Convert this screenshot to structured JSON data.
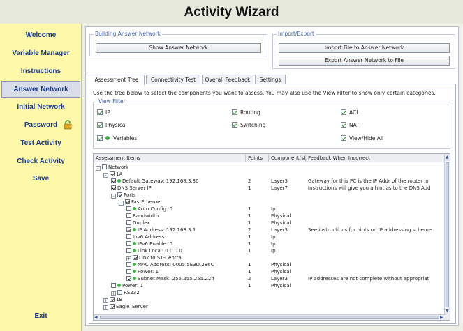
{
  "app": {
    "title": "Activity Wizard"
  },
  "sidebar": {
    "items": [
      {
        "label": "Welcome"
      },
      {
        "label": "Variable Manager"
      },
      {
        "label": "Instructions"
      },
      {
        "label": "Answer Network"
      },
      {
        "label": "Initial Network"
      },
      {
        "label": "Password"
      },
      {
        "label": "Test Activity"
      },
      {
        "label": "Check Activity"
      },
      {
        "label": "Save"
      }
    ],
    "active": "Answer Network",
    "exit_label": "Exit"
  },
  "building": {
    "group_title": "Building Answer Network",
    "show_button": "Show Answer Network"
  },
  "import_export": {
    "group_title": "Import/Export",
    "import_button": "Import File to Answer Network",
    "export_button": "Export Answer Network to File"
  },
  "tabs": [
    {
      "label": "Assessment Tree",
      "active": true
    },
    {
      "label": "Connectivity Test",
      "active": false
    },
    {
      "label": "Overall Feedback",
      "active": false
    },
    {
      "label": "Settings",
      "active": false
    }
  ],
  "instruction": "Use the tree below to select the components you want to assess. You may also use the View Filter to show only certain categories.",
  "view_filter": {
    "title": "View Filter",
    "options": [
      {
        "label": "IP",
        "checked": true
      },
      {
        "label": "Routing",
        "checked": true
      },
      {
        "label": "ACL",
        "checked": true
      },
      {
        "label": "Physical",
        "checked": true
      },
      {
        "label": "Switching",
        "checked": true
      },
      {
        "label": "NAT",
        "checked": true
      },
      {
        "label": "Variables",
        "checked": true
      },
      {
        "label": "View/Hide All",
        "checked": true
      }
    ]
  },
  "grid": {
    "columns": [
      "Assessment Items",
      "Points",
      "Component(s)",
      "Feedback When Incorrect"
    ],
    "rows": [
      {
        "label": "Network",
        "level": 0,
        "expand": "-",
        "check": false,
        "dot": false,
        "points": "",
        "component": "",
        "feedback": ""
      },
      {
        "label": "1A",
        "level": 1,
        "expand": "-",
        "check": true,
        "dot": false,
        "points": "",
        "component": "",
        "feedback": ""
      },
      {
        "label": "Default Gateway: 192.168.3.30",
        "level": 2,
        "expand": "",
        "check": true,
        "dot": true,
        "points": "2",
        "component": "Layer3",
        "feedback": "Gateway for this PC is the IP Addr of the router in"
      },
      {
        "label": "DNS Server IP",
        "level": 2,
        "expand": "",
        "check": true,
        "dot": false,
        "points": "1",
        "component": "Layer7",
        "feedback": "Instructions will give you a hint as to the DNS Add"
      },
      {
        "label": "Ports",
        "level": 2,
        "expand": "-",
        "check": true,
        "dot": false,
        "points": "",
        "component": "",
        "feedback": ""
      },
      {
        "label": "FastEthernet",
        "level": 3,
        "expand": "-",
        "check": true,
        "dot": false,
        "points": "",
        "component": "",
        "feedback": ""
      },
      {
        "label": "Auto Config: 0",
        "level": 4,
        "expand": "",
        "check": false,
        "dot": true,
        "points": "1",
        "component": "Ip",
        "feedback": ""
      },
      {
        "label": "Bandwidth",
        "level": 4,
        "expand": "",
        "check": false,
        "dot": false,
        "points": "1",
        "component": "Physical",
        "feedback": ""
      },
      {
        "label": "Duplex",
        "level": 4,
        "expand": "",
        "check": false,
        "dot": false,
        "points": "1",
        "component": "Physical",
        "feedback": ""
      },
      {
        "label": "IP Address: 192.168.3.1",
        "level": 4,
        "expand": "",
        "check": true,
        "dot": true,
        "points": "2",
        "component": "Layer3",
        "feedback": "See instructions for hints on IP addressing scheme"
      },
      {
        "label": "Ipv6 Address",
        "level": 4,
        "expand": "",
        "check": false,
        "dot": false,
        "points": "1",
        "component": "Ip",
        "feedback": ""
      },
      {
        "label": "IPv6 Enable: 0",
        "level": 4,
        "expand": "",
        "check": false,
        "dot": true,
        "points": "1",
        "component": "Ip",
        "feedback": ""
      },
      {
        "label": "Link Local: 0.0.0.0",
        "level": 4,
        "expand": "",
        "check": false,
        "dot": true,
        "points": "1",
        "component": "Ip",
        "feedback": ""
      },
      {
        "label": "Link to S1-Central",
        "level": 4,
        "expand": "+",
        "check": true,
        "dot": false,
        "points": "",
        "component": "",
        "feedback": ""
      },
      {
        "label": "MAC Address: 0005.5E3D.286C",
        "level": 4,
        "expand": "",
        "check": false,
        "dot": true,
        "points": "1",
        "component": "Physical",
        "feedback": ""
      },
      {
        "label": "Power: 1",
        "level": 4,
        "expand": "",
        "check": false,
        "dot": true,
        "points": "1",
        "component": "Physical",
        "feedback": ""
      },
      {
        "label": "Subnet Mask: 255.255.255.224",
        "level": 4,
        "expand": "",
        "check": true,
        "dot": true,
        "points": "2",
        "component": "Layer3",
        "feedback": "IP addresses are not complete without appropriat"
      },
      {
        "label": "Power: 1",
        "level": 2,
        "expand": "",
        "check": false,
        "dot": true,
        "points": "1",
        "component": "Physical",
        "feedback": ""
      },
      {
        "label": "RS232",
        "level": 2,
        "expand": "+",
        "check": false,
        "dot": false,
        "points": "",
        "component": "",
        "feedback": ""
      },
      {
        "label": "1B",
        "level": 1,
        "expand": "+",
        "check": true,
        "dot": false,
        "points": "",
        "component": "",
        "feedback": ""
      },
      {
        "label": "Eagle_Server",
        "level": 1,
        "expand": "+",
        "check": true,
        "dot": false,
        "points": "",
        "component": "",
        "feedback": ""
      }
    ]
  },
  "colors": {
    "sidebar_bg": "#fdf9a8",
    "nav_text": "#1c3a8c",
    "status_dot": "#3cb043"
  },
  "icons": {
    "lock": "padlock-icon"
  }
}
